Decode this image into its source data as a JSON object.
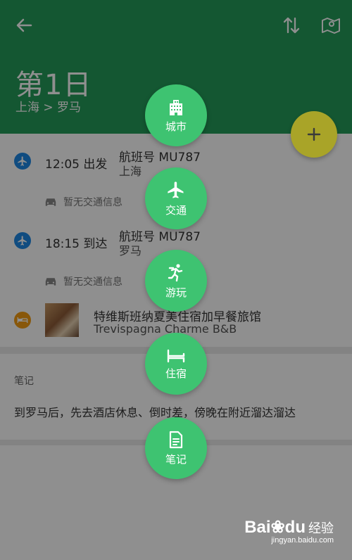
{
  "header": {
    "day_title": "第1日",
    "route": "上海 > 罗马",
    "icons": [
      "back-arrow-icon",
      "swap-icon",
      "map-pin-icon"
    ]
  },
  "itinerary": {
    "departure": {
      "time_label": "12:05 出发",
      "flight_label": "航班号 MU787",
      "city": "上海"
    },
    "transport_1": "暂无交通信息",
    "arrival": {
      "time_label": "18:15 到达",
      "flight_label": "航班号 MU787",
      "city": "罗马"
    },
    "transport_2": "暂无交通信息",
    "hotel": {
      "name_cn": "特维斯班纳夏美住宿加早餐旅馆",
      "name_en": "Trevispagna Charme B&B"
    }
  },
  "notes": {
    "label": "笔记",
    "text": "到罗马后，先去酒店休息、倒时差，傍晚在附近溜达溜达"
  },
  "menu": {
    "city": "城市",
    "transport": "交通",
    "play": "游玩",
    "stay": "住宿",
    "note": "笔记"
  },
  "fab": {
    "icon": "plus-icon"
  },
  "watermark": {
    "logo_text": "Bai",
    "logo_suffix": "du",
    "cn_text": "经验",
    "url": "jingyan.baidu.com"
  },
  "colors": {
    "header_green": "#259b5a",
    "menu_green": "#3ec371",
    "fab_olive": "#a9a428",
    "flight_dot_blue": "#1e88e5",
    "hotel_dot_orange": "#f39c12"
  }
}
